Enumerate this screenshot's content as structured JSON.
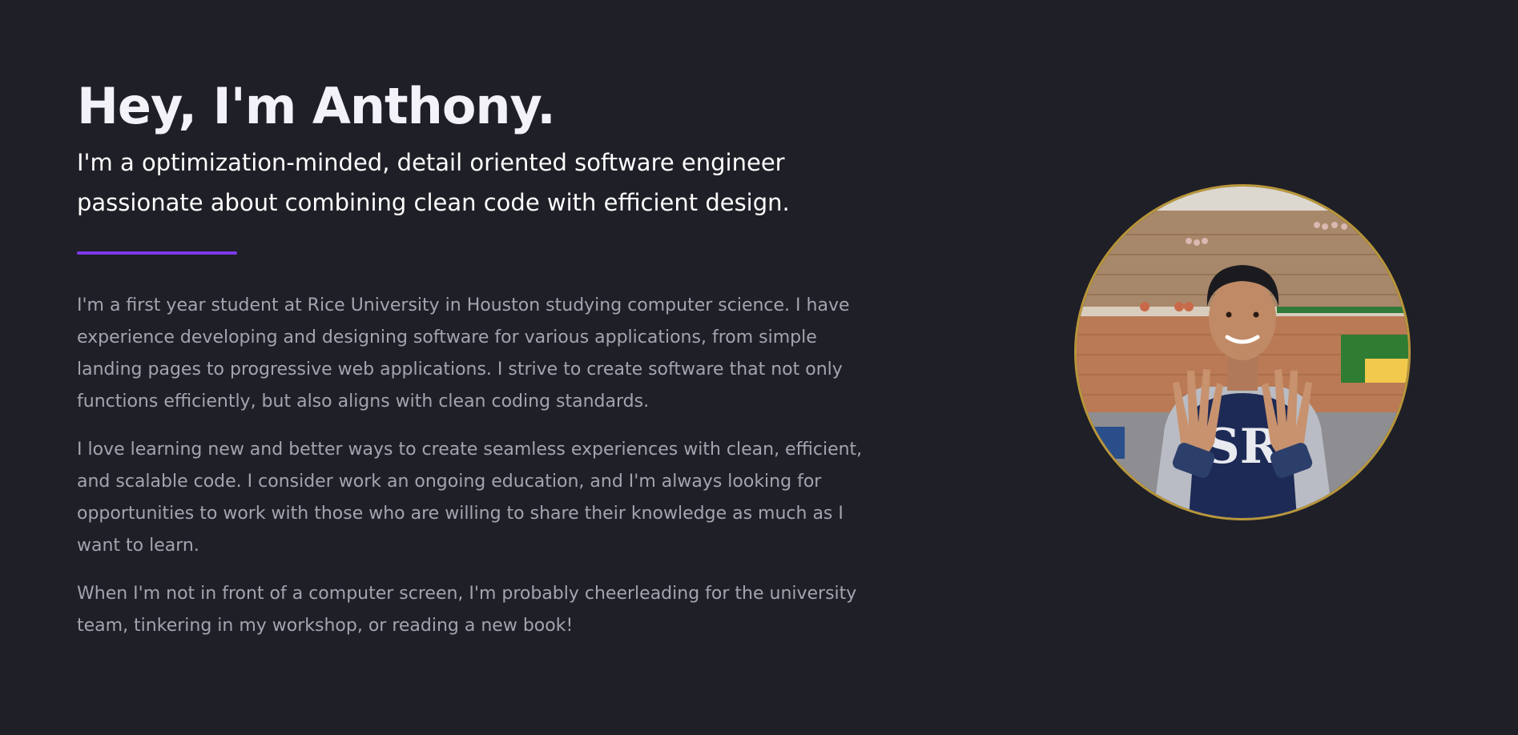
{
  "hero": {
    "headline": "Hey, I'm Anthony.",
    "tagline": "I'm a optimization-minded, detail oriented software engineer passionate about combining clean code with efficient design."
  },
  "bio": {
    "paragraphs": [
      "I'm a first year student at Rice University in Houston studying computer science. I have experience developing and designing software for various applications, from simple landing pages to progressive web applications. I strive to create software that not only functions efficiently, but also aligns with clean coding standards.",
      "I love learning new and better ways to create seamless experiences with clean, efficient, and scalable code. I consider work an ongoing education, and I'm always looking for opportunities to work with those who are willing to share their knowledge as much as I want to learn.",
      "When I'm not in front of a computer screen, I'm probably cheerleading for the university team, tinkering in my workshop, or reading a new book!"
    ]
  },
  "portrait": {
    "shirt_text": "SR"
  },
  "colors": {
    "background": "#1f1f27",
    "accent": "#7c3aed",
    "portrait_ring": "#b8963a"
  }
}
